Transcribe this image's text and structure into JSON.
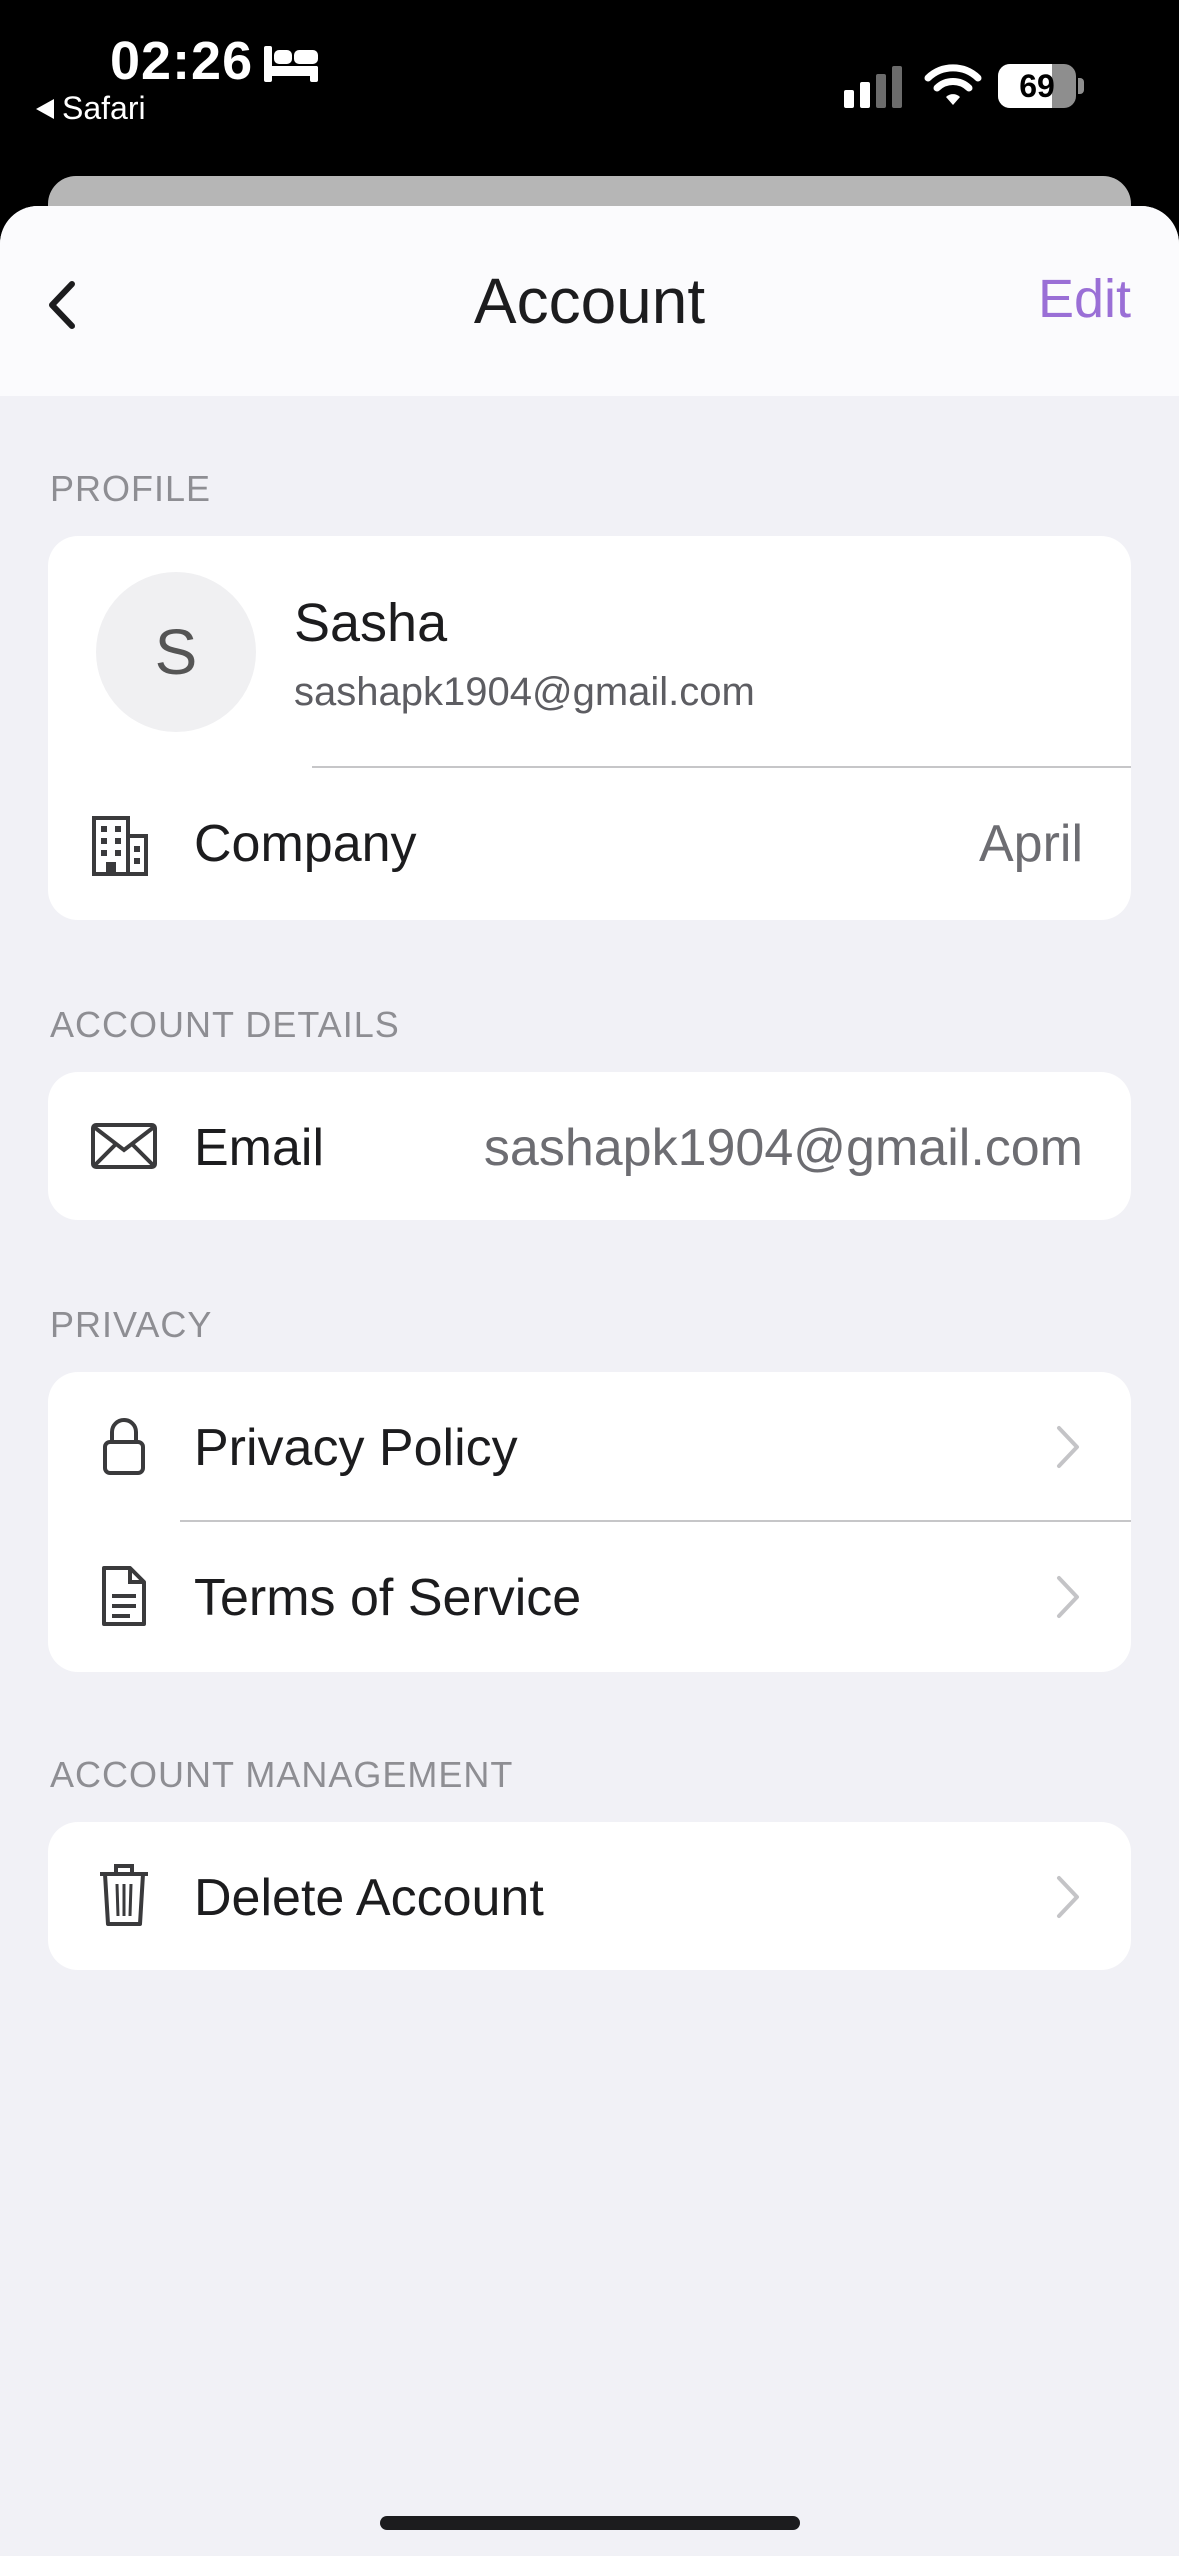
{
  "status_bar": {
    "time": "02:26",
    "back_app": "Safari",
    "battery": "69",
    "battery_level": 0.69
  },
  "nav": {
    "title": "Account",
    "edit_label": "Edit"
  },
  "sections": {
    "profile": "PROFILE",
    "account_details": "ACCOUNT DETAILS",
    "privacy": "PRIVACY",
    "account_management": "ACCOUNT MANAGEMENT"
  },
  "profile": {
    "initial": "S",
    "name": "Sasha",
    "email": "sashapk1904@gmail.com",
    "company_label": "Company",
    "company_value": "April"
  },
  "account_details": {
    "email_label": "Email",
    "email_value": "sashapk1904@gmail.com"
  },
  "privacy": {
    "privacy_policy": "Privacy Policy",
    "terms_of_service": "Terms of Service"
  },
  "account_management": {
    "delete_account": "Delete Account"
  },
  "colors": {
    "accent": "#9a6fd6",
    "background": "#f1f1f6"
  },
  "icons": [
    "bed-icon",
    "signal-icon",
    "wifi-icon",
    "battery-icon",
    "back-chevron-icon",
    "building-icon",
    "envelope-icon",
    "lock-icon",
    "document-icon",
    "trash-icon",
    "chevron-right-icon"
  ]
}
